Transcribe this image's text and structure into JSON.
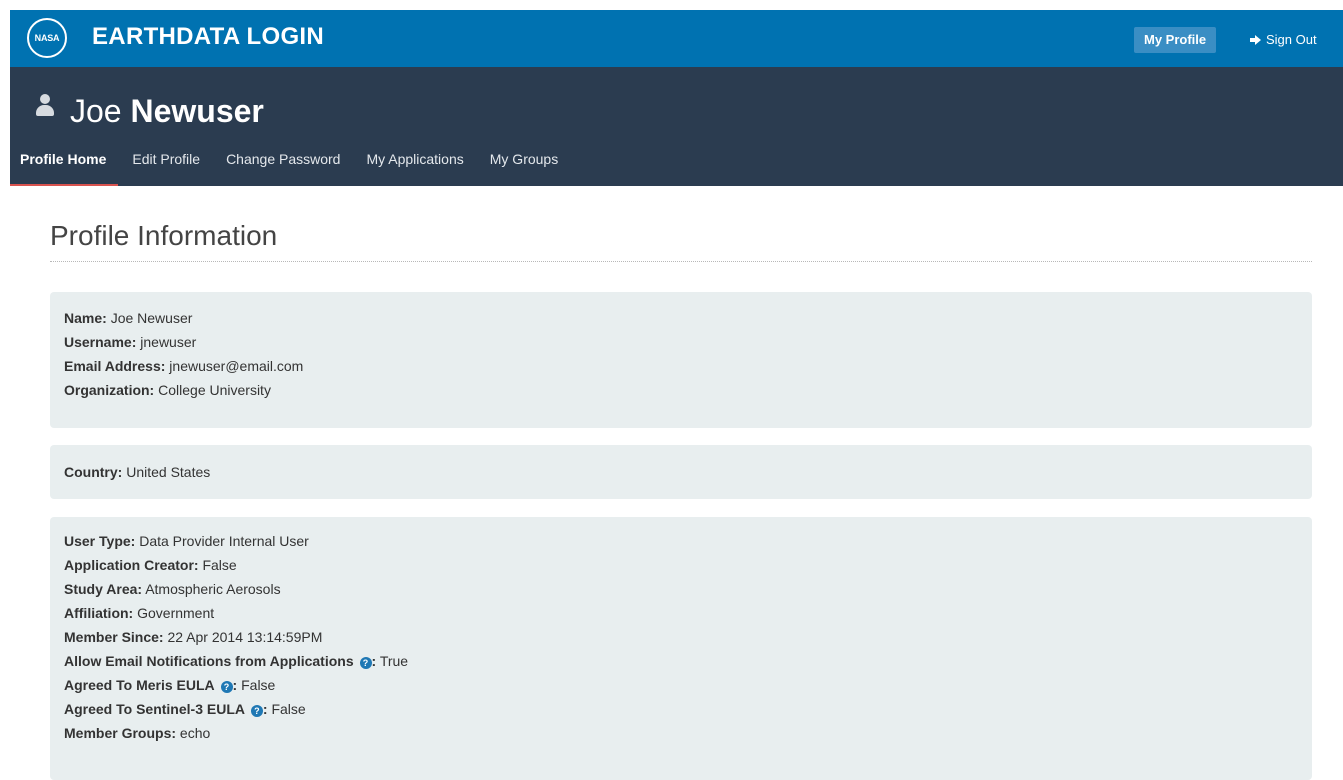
{
  "topbar": {
    "logo_text": "NASA",
    "brand": "EARTHDATA LOGIN",
    "my_profile": "My Profile",
    "sign_out": "Sign Out"
  },
  "user": {
    "first": "Joe",
    "last": "Newuser"
  },
  "tabs": [
    {
      "label": "Profile Home",
      "active": true
    },
    {
      "label": "Edit Profile"
    },
    {
      "label": "Change Password"
    },
    {
      "label": "My Applications"
    },
    {
      "label": "My Groups"
    }
  ],
  "section_title": "Profile Information",
  "panel1": {
    "name": {
      "label": "Name:",
      "value": "Joe Newuser"
    },
    "username": {
      "label": "Username:",
      "value": "jnewuser"
    },
    "email": {
      "label": "Email Address:",
      "value": "jnewuser@email.com"
    },
    "organization": {
      "label": "Organization:",
      "value": "College University"
    }
  },
  "panel2": {
    "country": {
      "label": "Country:",
      "value": "United States"
    }
  },
  "panel3": {
    "user_type": {
      "label": "User Type:",
      "value": "Data Provider Internal User"
    },
    "app_creator": {
      "label": "Application Creator:",
      "value": "False"
    },
    "study_area": {
      "label": "Study Area:",
      "value": "Atmospheric Aerosols"
    },
    "affiliation": {
      "label": "Affiliation:",
      "value": "Government"
    },
    "member_since": {
      "label": "Member Since:",
      "value": "22 Apr 2014 13:14:59PM"
    },
    "email_notif": {
      "label": "Allow Email Notifications from Applications",
      "value": "True"
    },
    "meris": {
      "label": "Agreed To Meris EULA",
      "value": "False"
    },
    "sentinel": {
      "label": "Agreed To Sentinel-3 EULA",
      "value": "False"
    },
    "groups": {
      "label": "Member Groups:",
      "value": "echo"
    }
  },
  "colors": {
    "topbar": "#0072b1",
    "subheader": "#2b3c50",
    "active_tab_underline": "#d9534f",
    "panel": "#e8eeef"
  }
}
